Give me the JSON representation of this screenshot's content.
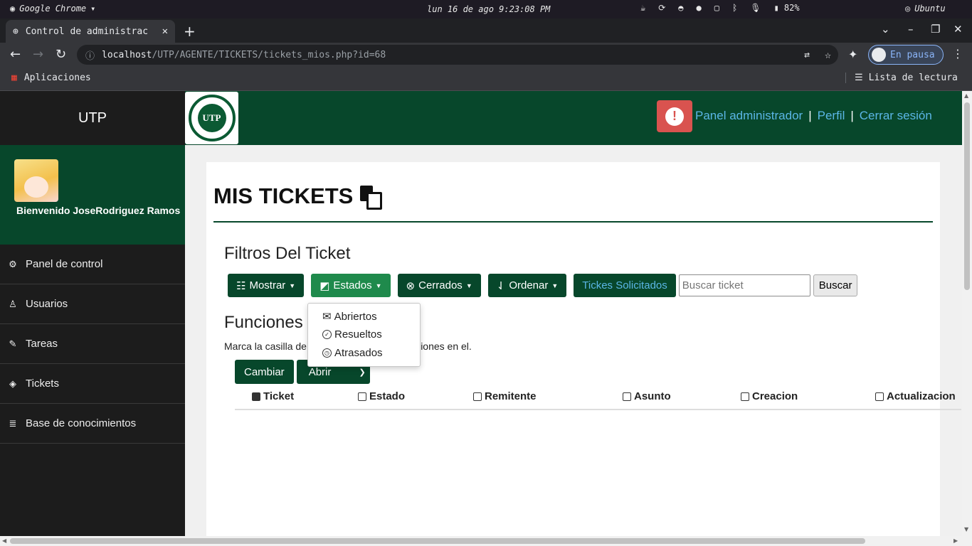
{
  "os": {
    "app_name": "Google Chrome",
    "clock": "lun 16 de ago   9:23:08 PM",
    "battery": "82%",
    "user": "Ubuntu"
  },
  "browser": {
    "tab_title": "Control de administrac",
    "url_host": "localhost",
    "url_path": "/UTP/AGENTE/TICKETS/tickets_mios.php?id=68",
    "profile_label": "En pausa",
    "bookmarks_apps": "Aplicaciones",
    "reading_list": "Lista de lectura"
  },
  "sidebar": {
    "brand": "UTP",
    "greeting": "Bienvenido JoseRodriguez Ramos",
    "items": [
      {
        "label": "Panel de control",
        "icon": "gears-icon"
      },
      {
        "label": "Usuarios",
        "icon": "user-icon"
      },
      {
        "label": "Tareas",
        "icon": "edit-icon"
      },
      {
        "label": "Tickets",
        "icon": "tags-icon"
      },
      {
        "label": "Base de conocimientos",
        "icon": "stack-icon"
      }
    ]
  },
  "topbar": {
    "logo_text": "UTP",
    "links": [
      "Panel administrador",
      "Perfil",
      "Cerrar sesión"
    ],
    "separator": "|"
  },
  "main": {
    "title": "MIS TICKETS",
    "filters_heading": "Filtros Del Ticket",
    "filter_buttons": [
      "Mostrar",
      "Estados",
      "Cerrados",
      "Ordenar"
    ],
    "requested_button": "Tickes Solicitados",
    "search_placeholder": "Buscar ticket",
    "search_button": "Buscar",
    "functions_heading": "Funciones",
    "functions_desc": "Marca la casilla de                          modificaciones en el.",
    "change_button": "Cambiar",
    "action_select": "Abrir",
    "columns": [
      "Ticket",
      "Estado",
      "Remitente",
      "Asunto",
      "Creacion",
      "Actualizacion"
    ]
  },
  "estados_dropdown": {
    "items": [
      "Abriertos",
      "Resueltos",
      "Atrasados"
    ]
  },
  "colors": {
    "brand_green": "#07472b",
    "active_green": "#1f8a4c",
    "alert_red": "#d9534f",
    "link_blue": "#5bb6e6"
  }
}
